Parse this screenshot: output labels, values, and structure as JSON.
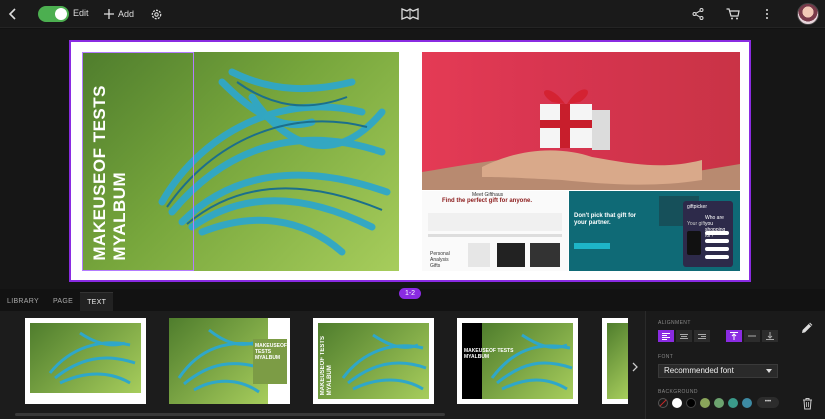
{
  "topbar": {
    "edit_label": "Edit",
    "add_label": "Add"
  },
  "left_page": {
    "title_line1": "MAKEUSEOF TESTS",
    "title_line2": "MYALBUM"
  },
  "right_page": {
    "shot1_heading": "Find the perfect gift for anyone.",
    "shot1_top": "Meet Gifthaus",
    "shot1_product": "Personal Analysis Gifts",
    "shot2_heading": "Don't pick that gift for your partner.",
    "shot2_app_title": "giftpicker",
    "shot2_app_question": "Who are you shopping for?",
    "shot2_app_sub": "Your gift"
  },
  "page_indicator": "1-2",
  "tabs": [
    {
      "label": "LIBRARY"
    },
    {
      "label": "PAGE"
    },
    {
      "label": "TEXT"
    }
  ],
  "thumbnails": [
    {
      "text": ""
    },
    {
      "text_line1": "MAKEUSEOF",
      "text_line2": "TESTS",
      "text_line3": "MYALBUM"
    },
    {
      "text_line1": "MAKEUSEOF TESTS",
      "text_line2": "MYALBUM"
    },
    {
      "text_line1": "MAKEUSEOF TESTS",
      "text_line2": "MYALBUM"
    },
    {
      "text": ""
    }
  ],
  "side_panel": {
    "alignment_label": "ALIGNMENT",
    "font_label": "FONT",
    "font_value": "Recommended font",
    "background_label": "BACKGROUND",
    "more_label": "•••"
  },
  "colors": {
    "accent": "#8a2be2",
    "toggle": "#4caf50",
    "swatches": [
      "#ffffff",
      "#000000",
      "#8aa55a",
      "#6ca36f",
      "#3a9a8a",
      "#3d8aa3"
    ]
  }
}
